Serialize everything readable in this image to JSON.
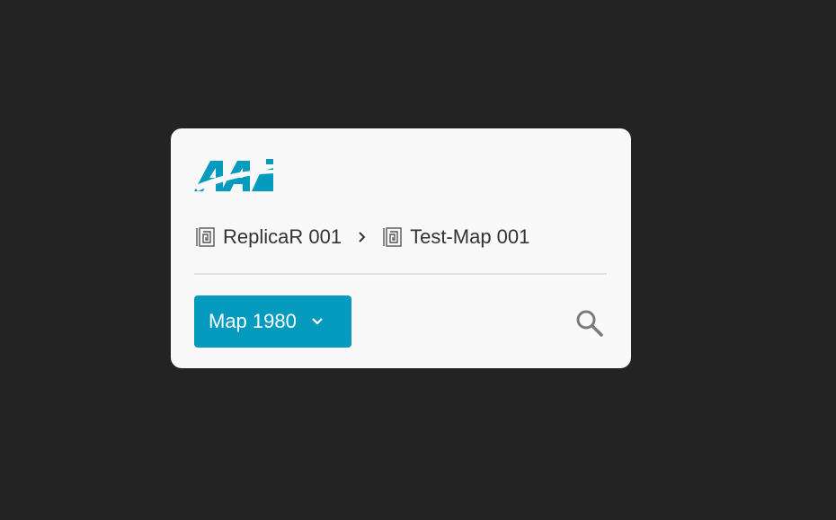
{
  "brand": {
    "logo_text": "AAi",
    "color": "#049bbf"
  },
  "breadcrumb": {
    "items": [
      {
        "label": "ReplicaR 001",
        "icon": "map-icon"
      },
      {
        "label": "Test-Map 001",
        "icon": "map-icon"
      }
    ],
    "separator_icon": "chevron-right-icon"
  },
  "map_selector": {
    "label": "Map 1980",
    "icon": "chevron-down-icon"
  },
  "search": {
    "icon": "search-icon"
  },
  "colors": {
    "background": "#232323",
    "card": "#f9f9f9",
    "accent": "#049bbf",
    "text": "#333333",
    "icon": "#7a7a7a"
  }
}
